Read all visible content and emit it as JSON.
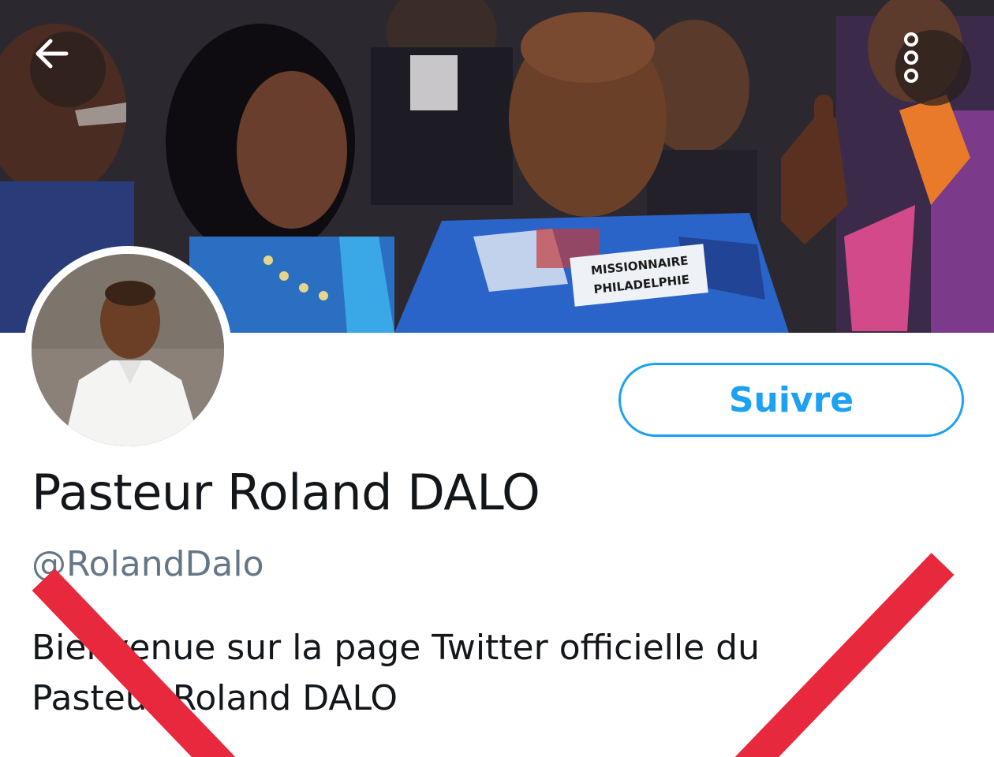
{
  "profile": {
    "display_name": "Pasteur Roland DALO",
    "handle": "@RolandDalo",
    "bio": "Bienvenue sur la page Twitter officielle du Pasteur Roland DALO",
    "follow_label": "Suivre"
  },
  "banner": {
    "shirt_text_line1": "MISSIONNAIRE",
    "shirt_text_line2": "PHILADELPHIE"
  },
  "icons": {
    "back": "arrow-left-icon",
    "more": "more-vertical-icon"
  },
  "colors": {
    "accent": "#1da1f2",
    "text_primary": "#14171a",
    "text_secondary": "#657786",
    "cross_mark": "#e8283c"
  }
}
